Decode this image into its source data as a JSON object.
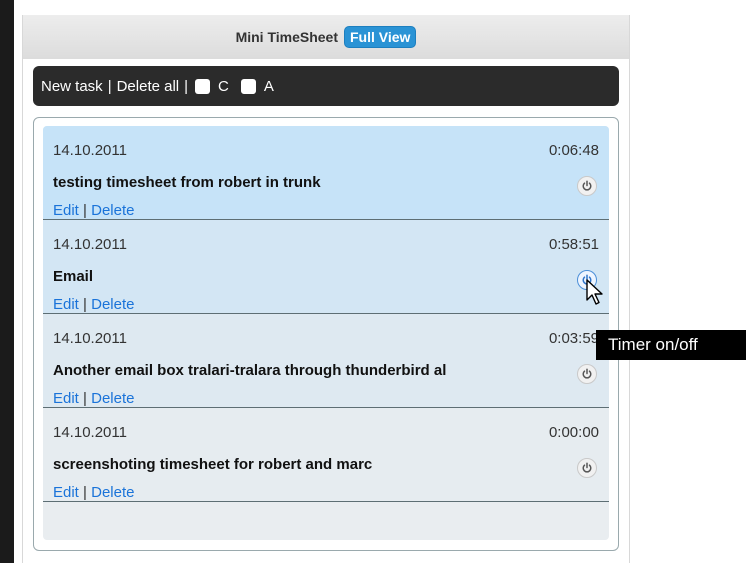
{
  "header": {
    "title": "Mini TimeSheet",
    "full_view_label": "Full View"
  },
  "toolbar": {
    "new_task": "New task",
    "sep1": "|",
    "delete_all": "Delete all",
    "sep2": "|",
    "checkbox_c_label": "C",
    "checkbox_a_label": "A"
  },
  "tasks": [
    {
      "date": "14.10.2011",
      "time": "0:06:48",
      "title": "testing timesheet from robert in trunk",
      "edit": "Edit",
      "sep": "|",
      "delete": "Delete",
      "bg": "#c6e3f8"
    },
    {
      "date": "14.10.2011",
      "time": "0:58:51",
      "title": "Email",
      "edit": "Edit",
      "sep": "|",
      "delete": "Delete",
      "bg": "#d3e6f4"
    },
    {
      "date": "14.10.2011",
      "time": "0:03:59",
      "title": "Another email box tralari-tralara through thunderbird al",
      "edit": "Edit",
      "sep": "|",
      "delete": "Delete",
      "bg": "#dee9f1"
    },
    {
      "date": "14.10.2011",
      "time": "0:00:00",
      "title": "screenshoting timesheet for robert and marc",
      "edit": "Edit",
      "sep": "|",
      "delete": "Delete",
      "bg": "#e6ecf0"
    }
  ],
  "tooltip": {
    "text": "Timer on/off"
  },
  "icons": {
    "timer_toggle": "power-icon",
    "pointer": "mouse-cursor-icon"
  },
  "colors": {
    "accent": "#2a93d5",
    "link": "#1a73d9",
    "toolbar_bg": "#2b2b2b"
  }
}
